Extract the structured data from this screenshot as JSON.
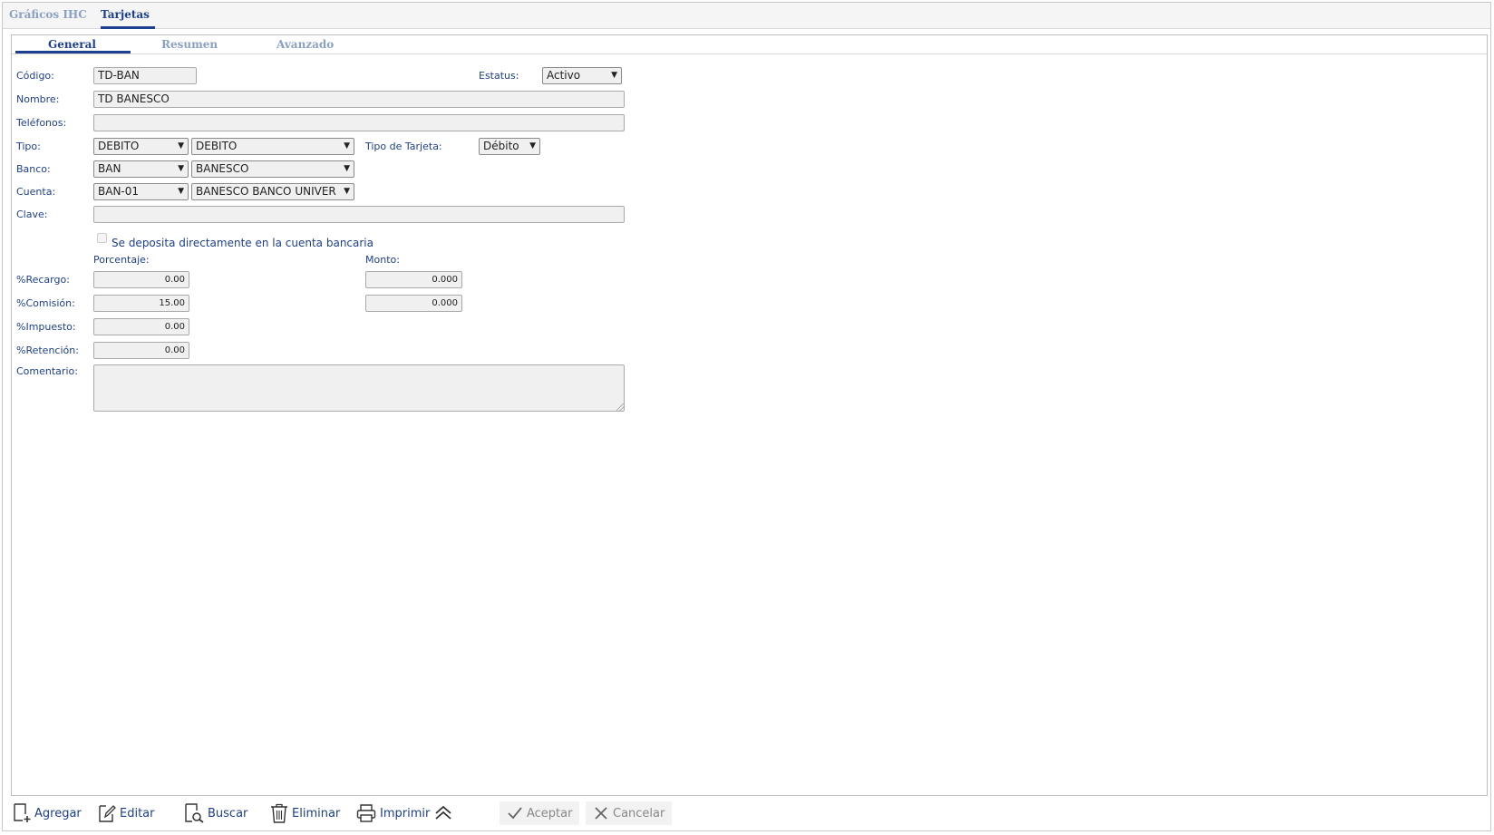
{
  "top_tabs": [
    {
      "label": "Gráficos IHC",
      "active": false
    },
    {
      "label": "Tarjetas",
      "active": true
    }
  ],
  "sub_tabs": [
    {
      "label": "General",
      "active": true
    },
    {
      "label": "Resumen",
      "active": false
    },
    {
      "label": "Avanzado",
      "active": false
    }
  ],
  "form": {
    "codigo": {
      "label": "Código:",
      "value": "TD-BAN"
    },
    "estatus": {
      "label": "Estatus:",
      "value": "Activo"
    },
    "nombre": {
      "label": "Nombre:",
      "value": "TD BANESCO"
    },
    "telefonos": {
      "label": "Teléfonos:",
      "value": ""
    },
    "tipo": {
      "label": "Tipo:",
      "code": "DEBITO",
      "name": "DEBITO"
    },
    "tipo_tarjeta": {
      "label": "Tipo de Tarjeta:",
      "value": "Débito"
    },
    "banco": {
      "label": "Banco:",
      "code": "BAN",
      "name": "BANESCO"
    },
    "cuenta": {
      "label": "Cuenta:",
      "code": "BAN-01",
      "name": "BANESCO BANCO UNIVER"
    },
    "clave": {
      "label": "Clave:",
      "value": ""
    },
    "deposito_directo": {
      "label": "Se deposita directamente en la cuenta bancaria",
      "checked": false
    },
    "porcentaje_header": "Porcentaje:",
    "monto_header": "Monto:",
    "recargo": {
      "label": "%Recargo:",
      "porcentaje": "0.00",
      "monto": "0.000"
    },
    "comision": {
      "label": "%Comisión:",
      "porcentaje": "15.00",
      "monto": "0.000"
    },
    "impuesto": {
      "label": "%Impuesto:",
      "porcentaje": "0.00"
    },
    "retencion": {
      "label": "%Retención:",
      "porcentaje": "0.00"
    },
    "comentario": {
      "label": "Comentario:",
      "value": ""
    }
  },
  "toolbar": {
    "agregar": "Agregar",
    "editar": "Editar",
    "buscar": "Buscar",
    "eliminar": "Eliminar",
    "imprimir": "Imprimir",
    "aceptar": "Aceptar",
    "cancelar": "Cancelar"
  },
  "colors": {
    "accent": "#1d3f8e",
    "inactive_tab": "#8aa0c4",
    "input_bg": "#f0f0f0"
  },
  "icons": [
    "add-document-icon",
    "edit-document-icon",
    "search-document-icon",
    "trash-icon",
    "printer-icon",
    "collapse-up-icon",
    "checkmark-icon",
    "close-x-icon",
    "dropdown-arrow-icon"
  ]
}
